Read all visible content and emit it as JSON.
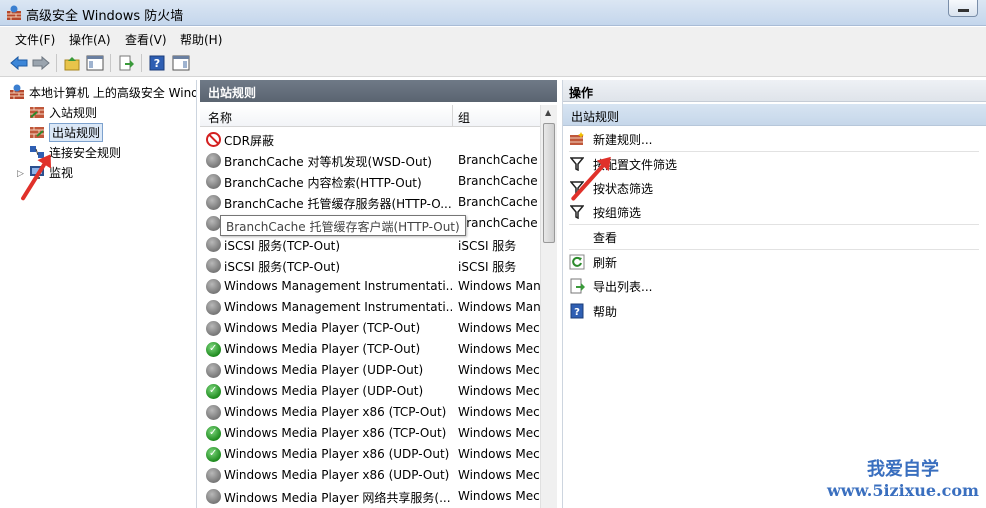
{
  "window": {
    "title": "高级安全 Windows 防火墙"
  },
  "menu": [
    "文件(F)",
    "操作(A)",
    "查看(V)",
    "帮助(H)"
  ],
  "tree": {
    "root": "本地计算机 上的高级安全 Windows",
    "items": [
      "入站规则",
      "出站规则",
      "连接安全规则",
      "监视"
    ]
  },
  "center": {
    "header": "出站规则",
    "columns": {
      "name": "名称",
      "group": "组"
    },
    "tooltip": "BranchCache 托管缓存客户端(HTTP-Out)",
    "rows": [
      {
        "name": "CDR屏蔽",
        "group": "",
        "status": "block"
      },
      {
        "name": "BranchCache 对等机发现(WSD-Out)",
        "group": "BranchCache -",
        "status": "disabled"
      },
      {
        "name": "BranchCache 内容检索(HTTP-Out)",
        "group": "BranchCache -",
        "status": "disabled"
      },
      {
        "name": "BranchCache 托管缓存服务器(HTTP-O...",
        "group": "BranchCache -",
        "status": "disabled"
      },
      {
        "name": "",
        "group": "BranchCache -",
        "status": "disabled"
      },
      {
        "name": "iSCSI 服务(TCP-Out)",
        "group": "iSCSI 服务",
        "status": "disabled"
      },
      {
        "name": "iSCSI 服务(TCP-Out)",
        "group": "iSCSI 服务",
        "status": "disabled"
      },
      {
        "name": "Windows Management Instrumentati...",
        "group": "Windows Man",
        "status": "disabled"
      },
      {
        "name": "Windows Management Instrumentati...",
        "group": "Windows Man",
        "status": "disabled"
      },
      {
        "name": "Windows Media Player (TCP-Out)",
        "group": "Windows Mec",
        "status": "disabled"
      },
      {
        "name": "Windows Media Player (TCP-Out)",
        "group": "Windows Mec",
        "status": "enabled"
      },
      {
        "name": "Windows Media Player (UDP-Out)",
        "group": "Windows Mec",
        "status": "disabled"
      },
      {
        "name": "Windows Media Player (UDP-Out)",
        "group": "Windows Mec",
        "status": "enabled"
      },
      {
        "name": "Windows Media Player x86 (TCP-Out)",
        "group": "Windows Mec",
        "status": "disabled"
      },
      {
        "name": "Windows Media Player x86 (TCP-Out)",
        "group": "Windows Mec",
        "status": "enabled"
      },
      {
        "name": "Windows Media Player x86 (UDP-Out)",
        "group": "Windows Mec",
        "status": "enabled"
      },
      {
        "name": "Windows Media Player x86 (UDP-Out)",
        "group": "Windows Mec",
        "status": "disabled"
      },
      {
        "name": "Windows Media Player 网络共享服务(...",
        "group": "Windows Mec",
        "status": "disabled"
      }
    ]
  },
  "actions": {
    "header": "操作",
    "section": "出站规则",
    "items": [
      "新建规则...",
      "按配置文件筛选",
      "按状态筛选",
      "按组筛选",
      "查看",
      "刷新",
      "导出列表...",
      "帮助"
    ]
  },
  "watermark": {
    "line1": "我爱自学",
    "line2": "www.5izixue.com"
  },
  "colors": {
    "accent_arrow": "#e0312a",
    "pane_header": "#5a6470"
  }
}
